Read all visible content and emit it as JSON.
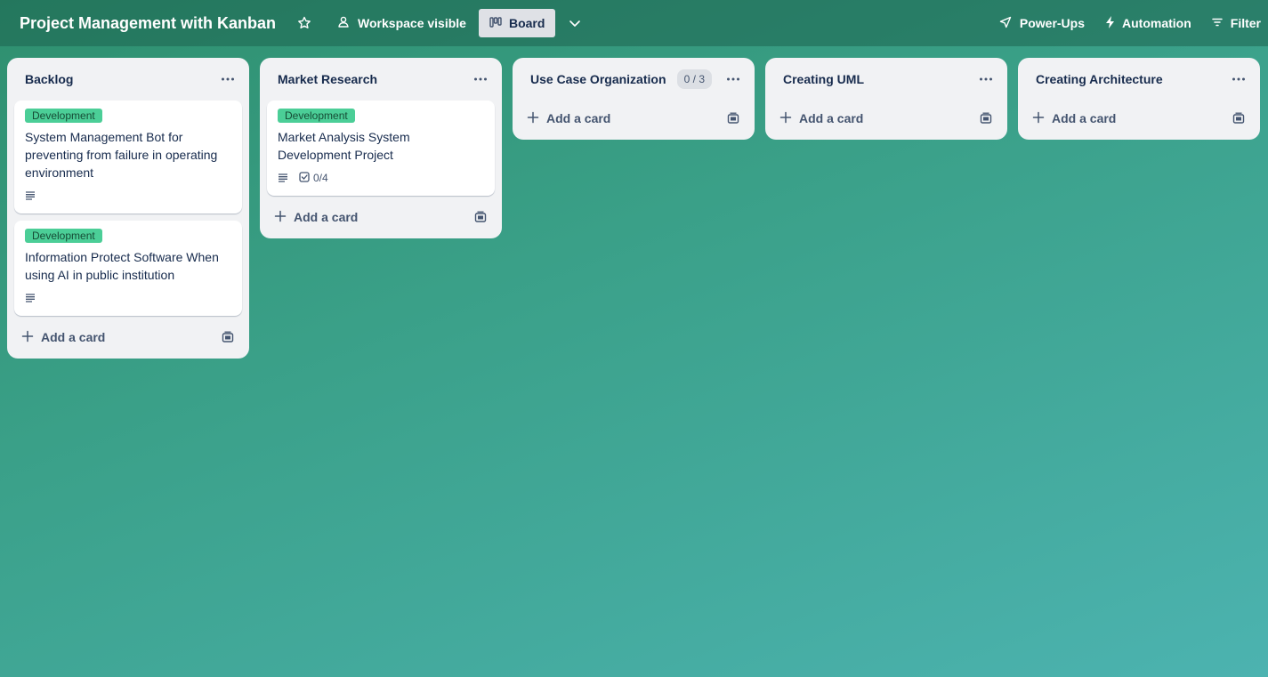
{
  "header": {
    "board_title": "Project Management with Kanban",
    "visibility_label": "Workspace visible",
    "view_label": "Board",
    "powerups_label": "Power-Ups",
    "automation_label": "Automation",
    "filter_label": "Filter"
  },
  "icons": {
    "star": "star-icon",
    "visibility": "people-icon",
    "board": "board-icon",
    "chevron": "chevron-down-icon",
    "powerups": "rocket-icon",
    "automation": "lightning-icon",
    "filter": "filter-icon",
    "menu": "more-icon",
    "add": "plus-icon",
    "template": "template-icon",
    "description": "description-icon",
    "checklist": "checklist-icon"
  },
  "colors": {
    "label_green": "#4bce97",
    "list_bg": "#f1f2f4"
  },
  "add_card_label": "Add a card",
  "lists": [
    {
      "title": "Backlog",
      "cards": [
        {
          "label": "Development",
          "title": "System Management Bot for preventing from failure in operating environment",
          "has_description": true
        },
        {
          "label": "Development",
          "title": "Information Protect Software When using AI in public institution",
          "has_description": true
        }
      ]
    },
    {
      "title": "Market Research",
      "cards": [
        {
          "label": "Development",
          "title": "Market Analysis System Development Project",
          "has_description": true,
          "checklist": "0/4"
        }
      ]
    },
    {
      "title": "Use Case Organization",
      "count": "0 / 3",
      "cards": []
    },
    {
      "title": "Creating UML",
      "cards": []
    },
    {
      "title": "Creating Architecture",
      "cards": []
    }
  ]
}
